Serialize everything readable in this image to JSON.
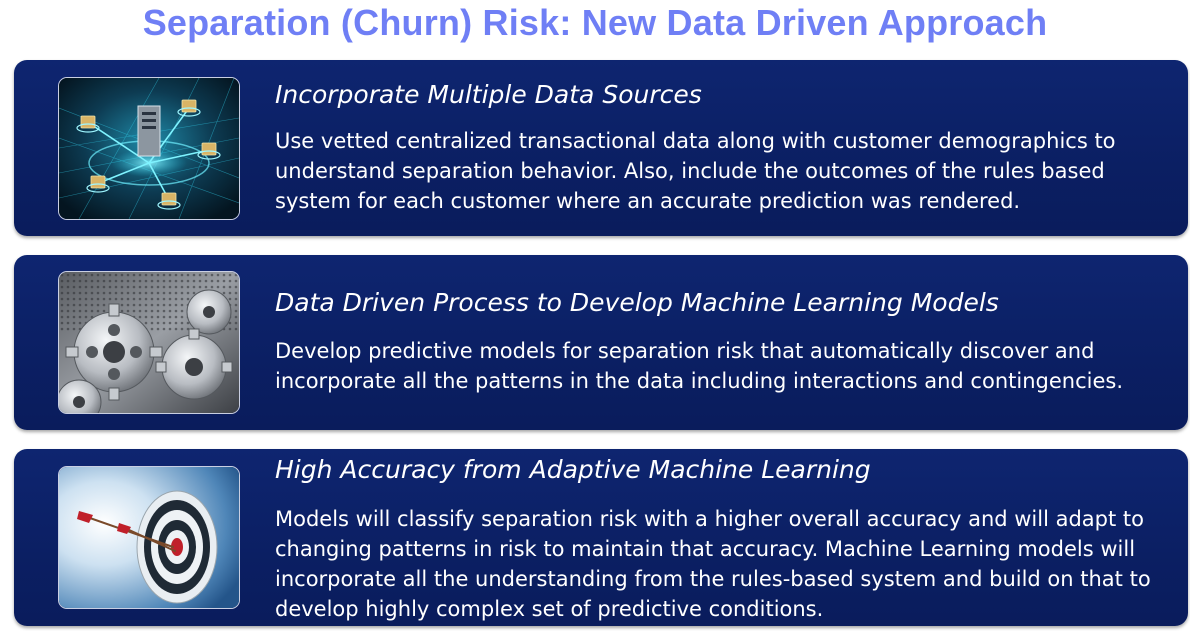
{
  "slide": {
    "title": "Separation (Churn) Risk: New Data Driven Approach"
  },
  "panels": [
    {
      "image_icon": "data-network-image",
      "heading": "Incorporate Multiple Data Sources",
      "body": "Use vetted centralized transactional data along with customer demographics to understand separation behavior. Also, include the outcomes of the rules based system for each customer where an accurate prediction was rendered."
    },
    {
      "image_icon": "gears-image",
      "heading": "Data Driven Process to Develop Machine Learning Models",
      "body": "Develop predictive models for separation risk that automatically discover and incorporate all the patterns in the data including interactions and contingencies."
    },
    {
      "image_icon": "target-arrow-image",
      "heading": "High Accuracy from Adaptive Machine Learning",
      "body": "Models will classify separation risk with a higher overall accuracy and will adapt to changing patterns in risk to maintain that accuracy. Machine Learning models will incorporate all the understanding from the rules-based system and build on that to develop highly complex set of predictive conditions."
    }
  ],
  "colors": {
    "title": "#6f7ff5",
    "panel_background": "#0b1f63",
    "panel_text": "#ffffff"
  }
}
